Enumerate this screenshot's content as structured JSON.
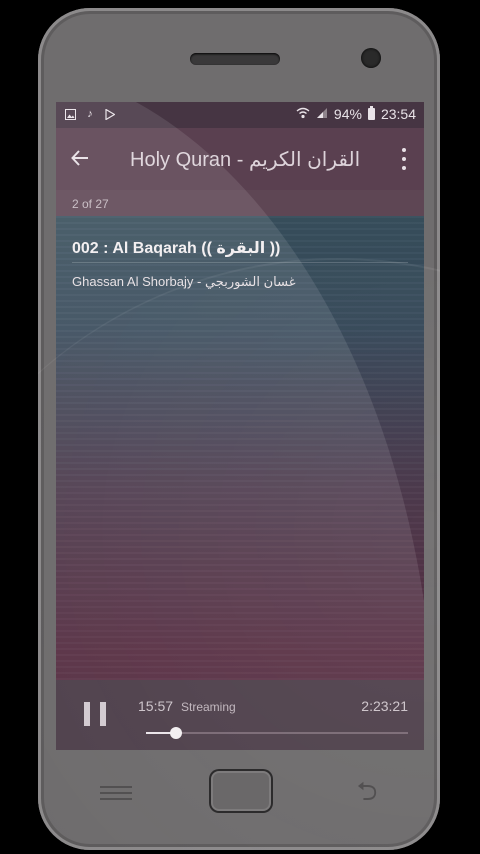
{
  "statusbar": {
    "left_icons": [
      "gallery-icon",
      "music-note-icon",
      "play-store-icon"
    ],
    "battery_percent": "94%",
    "time": "23:54"
  },
  "toolbar": {
    "title": "Holy Quran - القران الكريم"
  },
  "playlist": {
    "position": "2 of 27"
  },
  "track": {
    "title": "002 : Al Baqarah (( البقرة ))",
    "reciter": "Ghassan Al Shorbajy - غسان الشوربجي"
  },
  "player": {
    "elapsed": "15:57",
    "status": "Streaming",
    "duration": "2:23:21",
    "progress_fraction": 0.115
  }
}
